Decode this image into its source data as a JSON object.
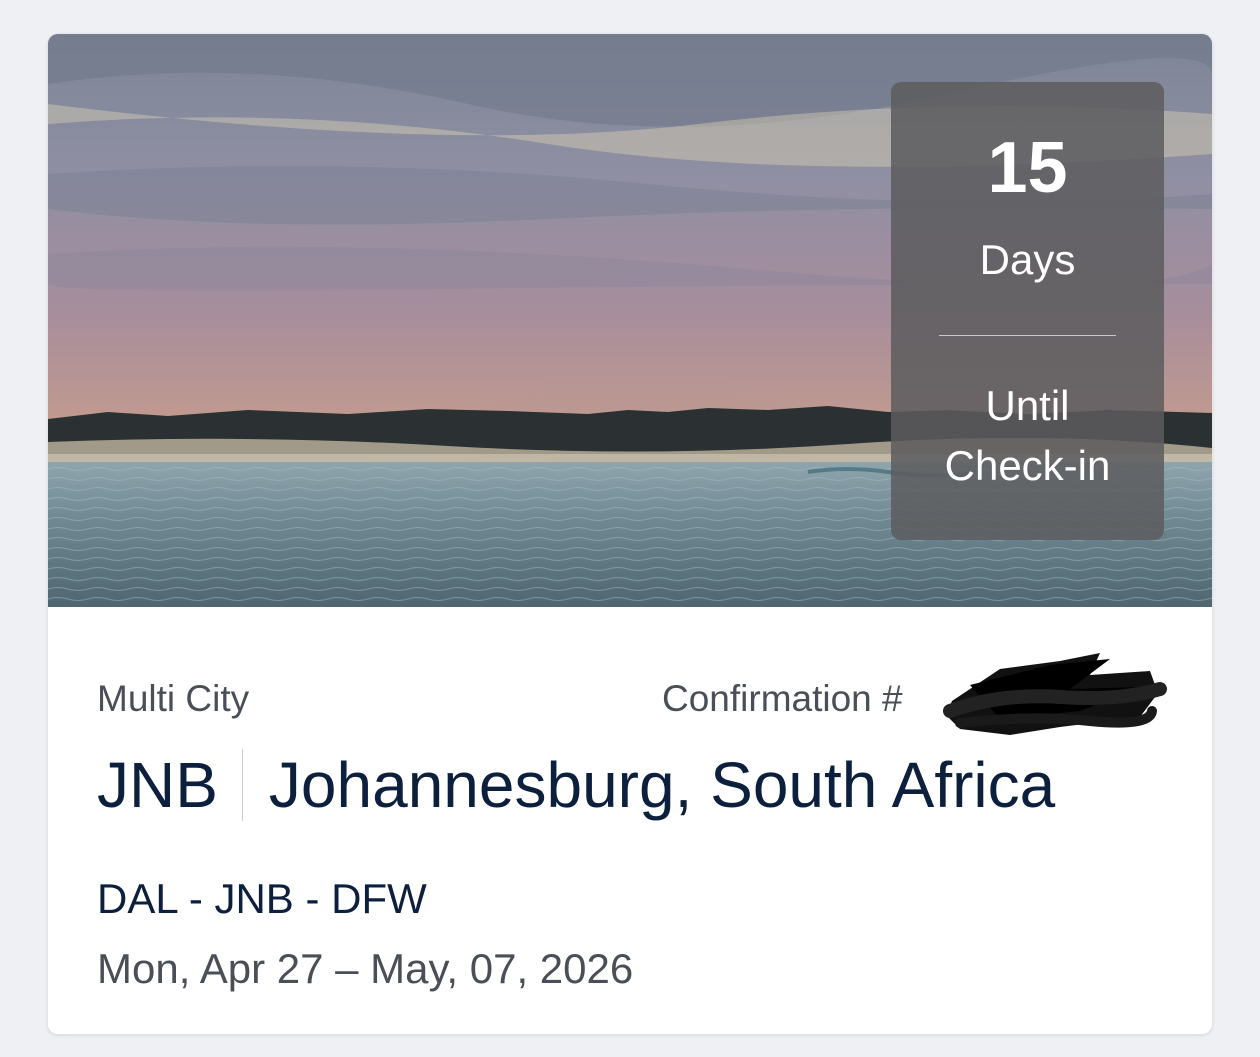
{
  "hero": {
    "image_name": "sunset-beach-photo"
  },
  "countdown": {
    "number": "15",
    "unit": "Days",
    "line1": "Until",
    "line2": "Check-in"
  },
  "trip": {
    "type": "Multi City",
    "confirmation_label": "Confirmation #",
    "airport_code": "JNB",
    "city": "Johannesburg, South Africa",
    "route": "DAL - JNB - DFW",
    "dates": "Mon, Apr 27 – May, 07, 2026"
  },
  "colors": {
    "navy": "#0c1f3d",
    "gray_text": "#4a4f57",
    "page_bg": "#eef0f3"
  }
}
